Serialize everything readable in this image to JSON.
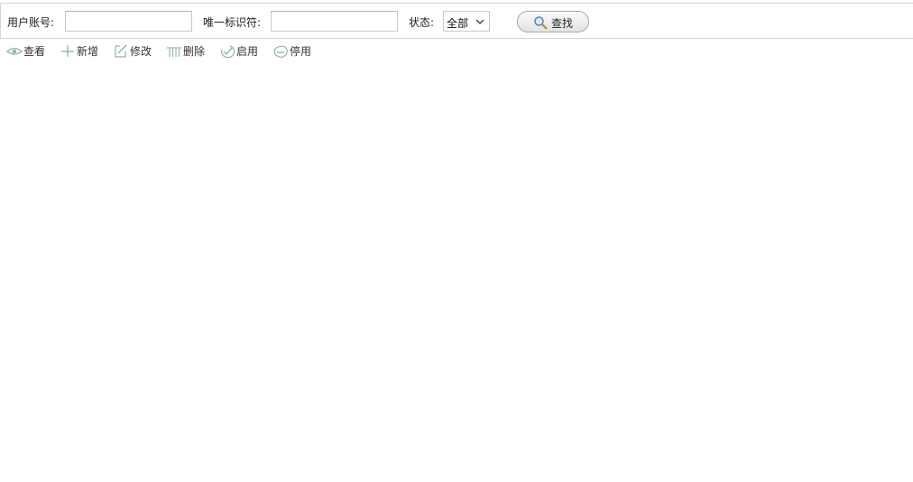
{
  "search": {
    "account_label": "用户账号:",
    "account_value": "",
    "uid_label": "唯一标识符:",
    "uid_value": "",
    "status_label": "状态:",
    "status_value": "全部",
    "find_label": "查找"
  },
  "toolbar": {
    "view_label": "查看",
    "add_label": "新增",
    "edit_label": "修改",
    "delete_label": "删除",
    "enable_label": "启用",
    "disable_label": "停用"
  },
  "colors": {
    "icon": "#8fb5a6",
    "border": "#d6d6d6"
  },
  "icons": [
    "eye-icon",
    "plus-icon",
    "edit-icon",
    "trash-icon",
    "check-circle-icon",
    "minus-circle-icon",
    "search-icon",
    "chevron-down-icon"
  ]
}
